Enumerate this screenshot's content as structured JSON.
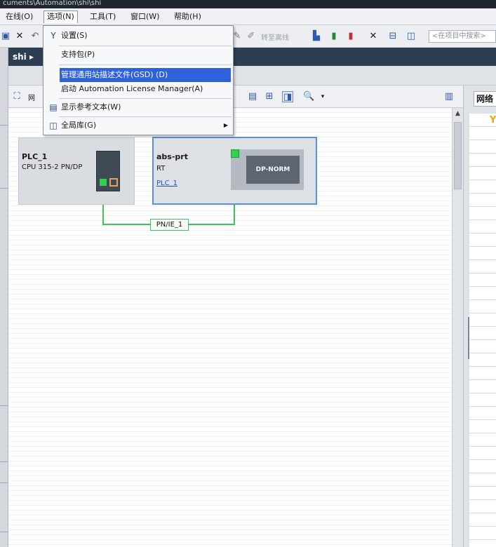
{
  "window": {
    "title_fragment": "cuments\\Automation\\shi\\shi"
  },
  "menubar": {
    "items": [
      {
        "label": "在线(O)"
      },
      {
        "label": "选项(N)"
      },
      {
        "label": "工具(T)"
      },
      {
        "label": "窗口(W)"
      },
      {
        "label": "帮助(H)"
      }
    ]
  },
  "toolbar": {
    "go_offline_label": "转至离线",
    "search_placeholder": "<在项目中搜索>"
  },
  "project": {
    "breadcrumb": "shi ▸"
  },
  "options_menu": {
    "items": [
      {
        "label": "设置(S)",
        "icon": "wrench-icon"
      },
      {
        "label": "支持包(P)"
      },
      {
        "label": "管理通用站描述文件(GSD) (D)",
        "highlighted": true
      },
      {
        "label": "启动 Automation License Manager(A)"
      },
      {
        "label": "显示参考文本(W)",
        "icon": "reference-text-icon"
      },
      {
        "label": "全局库(G)",
        "icon": "library-icon",
        "has_submenu": true
      }
    ]
  },
  "canvas": {
    "view_tab_label": "网",
    "right_panel_tab": "网络"
  },
  "devices": {
    "plc": {
      "name": "PLC_1",
      "type": "CPU 315-2 PN/DP"
    },
    "abs": {
      "name": "abs-prt",
      "type": "RT",
      "link": "PLC_1",
      "module_label": "DP-NORM"
    }
  },
  "network": {
    "label": "PN/IE_1",
    "color": "#3cc35a"
  },
  "colors": {
    "selection": "#2f62d8",
    "device_border": "#5b8fd8",
    "project_bar": "#2c3e50"
  }
}
